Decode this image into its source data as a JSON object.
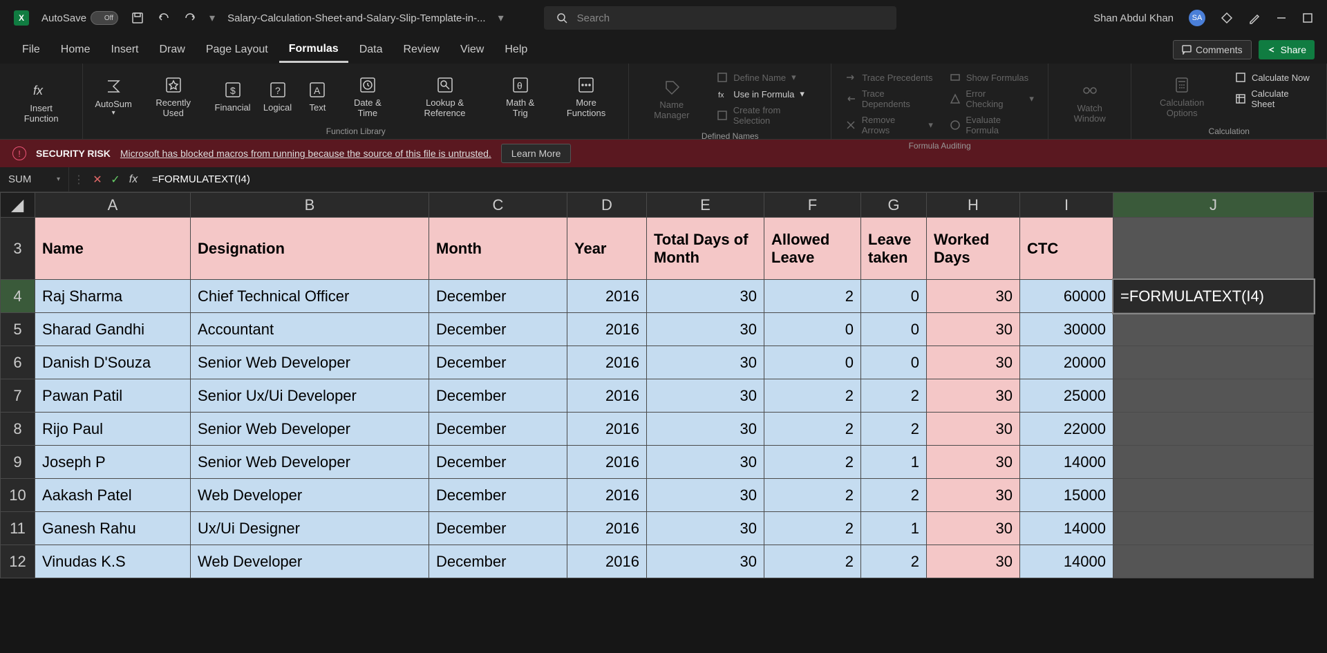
{
  "title": {
    "autosave": "AutoSave",
    "autosave_state": "Off",
    "filename": "Salary-Calculation-Sheet-and-Salary-Slip-Template-in-...",
    "search_placeholder": "Search",
    "user": "Shan Abdul Khan",
    "avatar": "SA"
  },
  "menu": {
    "file": "File",
    "home": "Home",
    "insert": "Insert",
    "draw": "Draw",
    "page_layout": "Page Layout",
    "formulas": "Formulas",
    "data": "Data",
    "review": "Review",
    "view": "View",
    "help": "Help",
    "comments": "Comments",
    "share": "Share"
  },
  "ribbon": {
    "insert_function": "Insert Function",
    "autosum": "AutoSum",
    "recently_used": "Recently Used",
    "financial": "Financial",
    "logical": "Logical",
    "text": "Text",
    "date_time": "Date & Time",
    "lookup_ref": "Lookup & Reference",
    "math_trig": "Math & Trig",
    "more_functions": "More Functions",
    "fn_library": "Function Library",
    "name_manager": "Name Manager",
    "define_name": "Define Name",
    "use_in_formula": "Use in Formula",
    "create_from_sel": "Create from Selection",
    "defined_names": "Defined Names",
    "trace_precedents": "Trace Precedents",
    "trace_dependents": "Trace Dependents",
    "remove_arrows": "Remove Arrows",
    "show_formulas": "Show Formulas",
    "error_checking": "Error Checking",
    "evaluate_formula": "Evaluate Formula",
    "formula_auditing": "Formula Auditing",
    "watch_window": "Watch Window",
    "calc_options": "Calculation Options",
    "calc_now": "Calculate Now",
    "calc_sheet": "Calculate Sheet",
    "calculation": "Calculation"
  },
  "security": {
    "title": "SECURITY RISK",
    "msg": "Microsoft has blocked macros from running because the source of this file is untrusted.",
    "learn": "Learn More"
  },
  "formula_bar": {
    "name_box": "SUM",
    "formula": "=FORMULATEXT(I4)"
  },
  "columns": [
    "A",
    "B",
    "C",
    "D",
    "E",
    "F",
    "G",
    "H",
    "I",
    "J"
  ],
  "headers": {
    "name": "Name",
    "designation": "Designation",
    "month": "Month",
    "year": "Year",
    "total_days": "Total Days of Month",
    "allowed_leave": "Allowed Leave",
    "leave_taken": "Leave taken",
    "worked_days": "Worked Days",
    "ctc": "CTC",
    "j": ""
  },
  "rows": [
    {
      "r": 4,
      "name": "Raj Sharma",
      "designation": "Chief Technical Officer",
      "month": "December",
      "year": 2016,
      "total_days": 30,
      "allowed_leave": 2,
      "leave_taken": 0,
      "worked_days": 30,
      "ctc": 60000,
      "j": "=FORMULATEXT(I4)"
    },
    {
      "r": 5,
      "name": "Sharad Gandhi",
      "designation": "Accountant",
      "month": "December",
      "year": 2016,
      "total_days": 30,
      "allowed_leave": 0,
      "leave_taken": 0,
      "worked_days": 30,
      "ctc": 30000,
      "j": ""
    },
    {
      "r": 6,
      "name": "Danish D'Souza",
      "designation": "Senior Web Developer",
      "month": "December",
      "year": 2016,
      "total_days": 30,
      "allowed_leave": 0,
      "leave_taken": 0,
      "worked_days": 30,
      "ctc": 20000,
      "j": ""
    },
    {
      "r": 7,
      "name": "Pawan Patil",
      "designation": "Senior Ux/Ui Developer",
      "month": "December",
      "year": 2016,
      "total_days": 30,
      "allowed_leave": 2,
      "leave_taken": 2,
      "worked_days": 30,
      "ctc": 25000,
      "j": ""
    },
    {
      "r": 8,
      "name": "Rijo Paul",
      "designation": "Senior Web Developer",
      "month": "December",
      "year": 2016,
      "total_days": 30,
      "allowed_leave": 2,
      "leave_taken": 2,
      "worked_days": 30,
      "ctc": 22000,
      "j": ""
    },
    {
      "r": 9,
      "name": "Joseph P",
      "designation": "Senior Web Developer",
      "month": "December",
      "year": 2016,
      "total_days": 30,
      "allowed_leave": 2,
      "leave_taken": 1,
      "worked_days": 30,
      "ctc": 14000,
      "j": ""
    },
    {
      "r": 10,
      "name": "Aakash Patel",
      "designation": "Web Developer",
      "month": "December",
      "year": 2016,
      "total_days": 30,
      "allowed_leave": 2,
      "leave_taken": 2,
      "worked_days": 30,
      "ctc": 15000,
      "j": ""
    },
    {
      "r": 11,
      "name": "Ganesh Rahu",
      "designation": "Ux/Ui Designer",
      "month": "December",
      "year": 2016,
      "total_days": 30,
      "allowed_leave": 2,
      "leave_taken": 1,
      "worked_days": 30,
      "ctc": 14000,
      "j": ""
    },
    {
      "r": 12,
      "name": "Vinudas K.S",
      "designation": "Web Developer",
      "month": "December",
      "year": 2016,
      "total_days": 30,
      "allowed_leave": 2,
      "leave_taken": 2,
      "worked_days": 30,
      "ctc": 14000,
      "j": ""
    }
  ]
}
